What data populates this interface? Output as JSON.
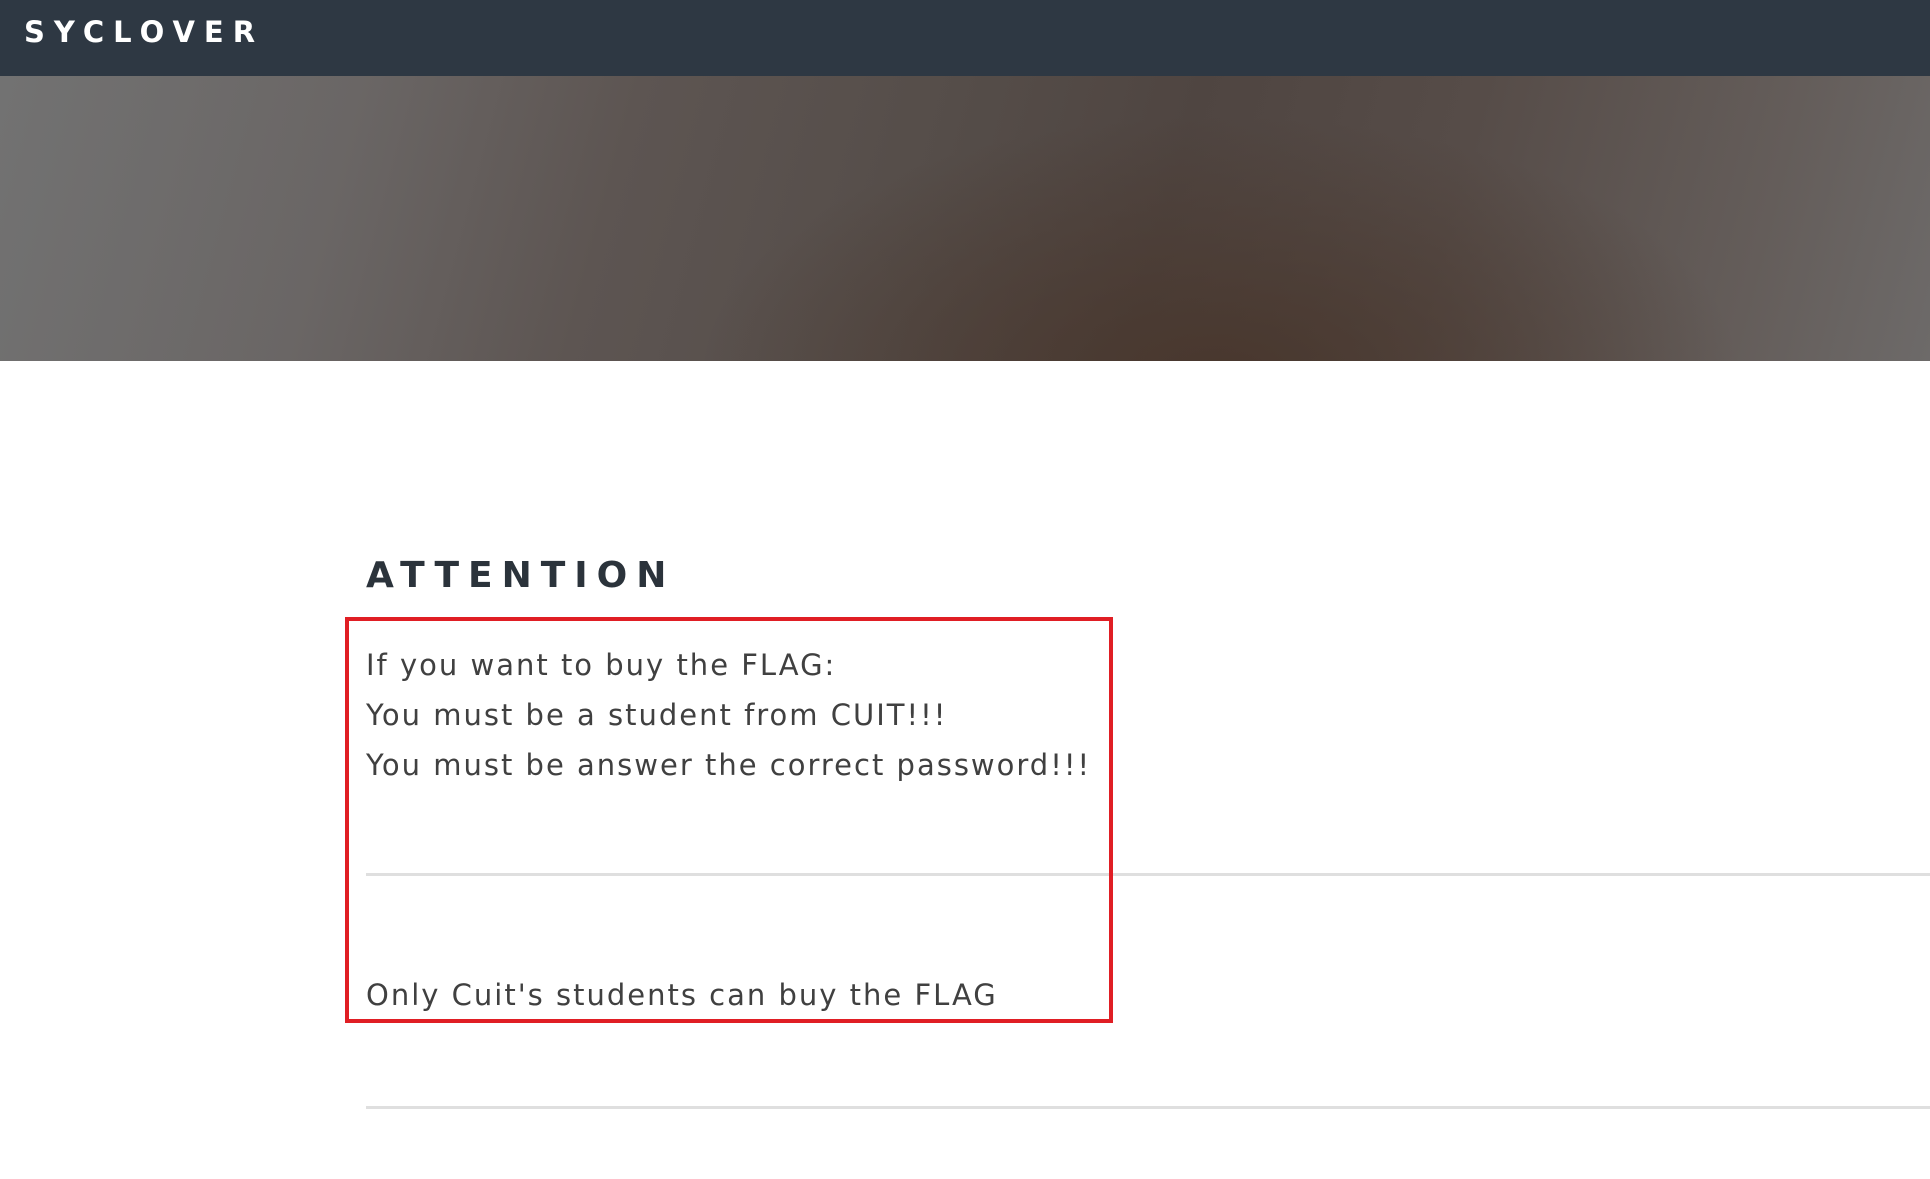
{
  "navbar": {
    "brand": "SYCLOVER"
  },
  "main": {
    "heading": "ATTENTION",
    "lines": [
      "If you want to buy the FLAG:",
      "You must be a student from CUIT!!!",
      "You must be answer the correct password!!!"
    ],
    "footnote": "Only Cuit's students can buy the FLAG"
  },
  "annotation": {
    "box_color": "#e01e24"
  }
}
